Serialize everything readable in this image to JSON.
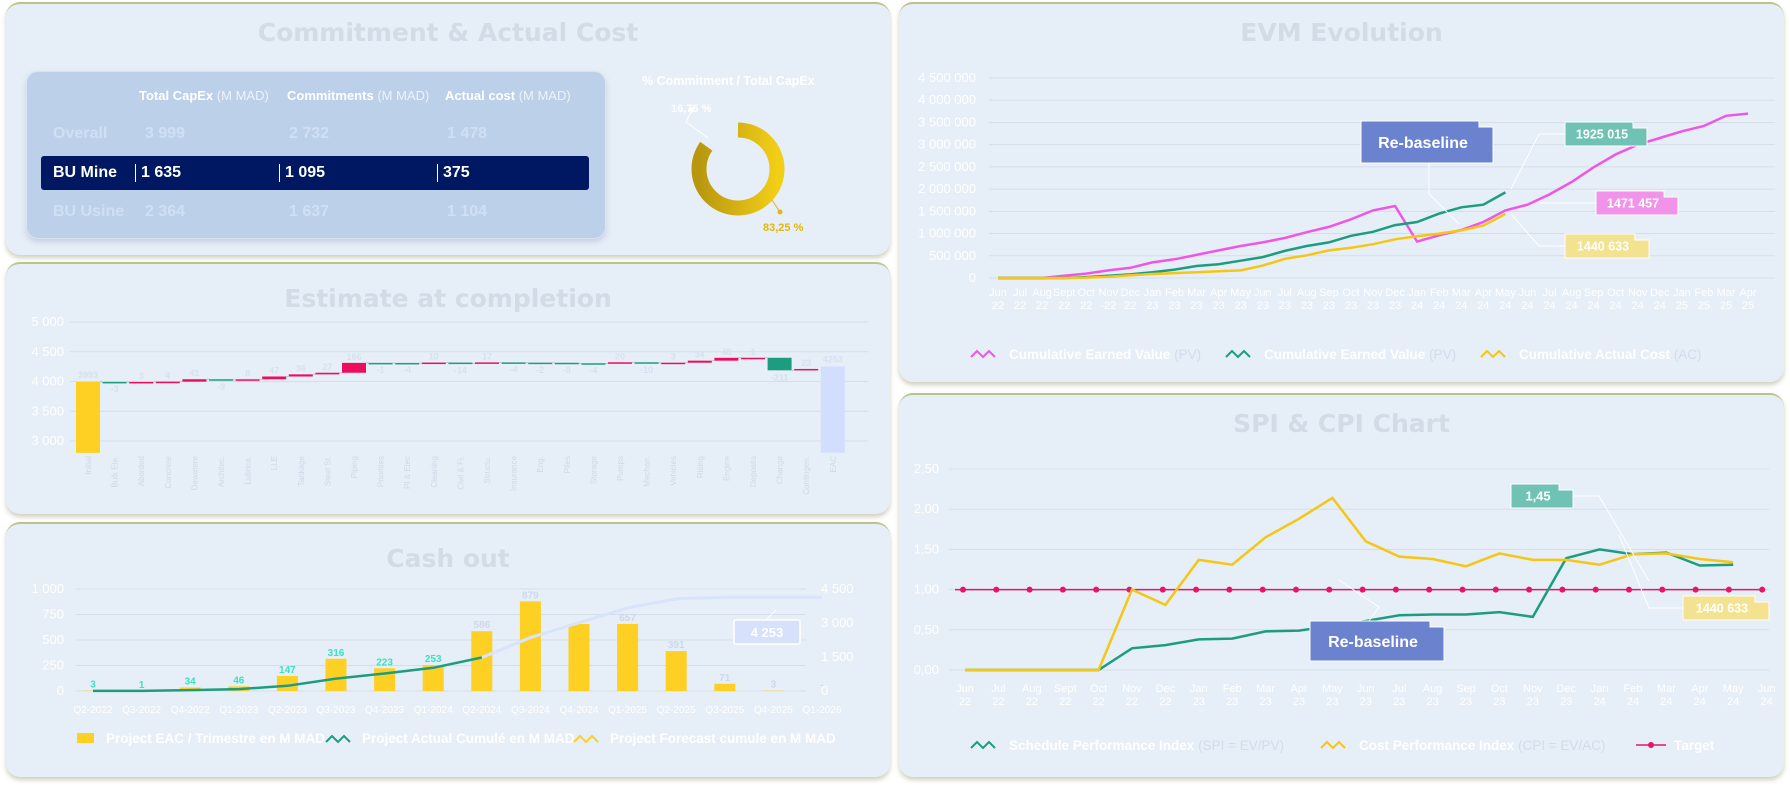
{
  "commitment": {
    "title": "Commitment & Actual Cost",
    "headers": [
      {
        "name": "Total CapEx",
        "unit": "(M MAD)"
      },
      {
        "name": "Commitments",
        "unit": "(M MAD)"
      },
      {
        "name": "Actual cost",
        "unit": "(M MAD)"
      }
    ],
    "rows": [
      {
        "label": "Overall",
        "total": "3 999",
        "commit": "2 732",
        "actual": "1 478"
      },
      {
        "label": "BU Mine",
        "total": "1 635",
        "commit": "1 095",
        "actual": "375"
      },
      {
        "label": "BU Usine",
        "total": "2 364",
        "commit": "1 637",
        "actual": "1 104"
      }
    ],
    "selected_row": 1,
    "donut": {
      "title": "% Commitment / Total CapEx",
      "small_label": "16,75 %",
      "large_label": "83,25 %",
      "small_pct": 16.75,
      "large_pct": 83.25,
      "colors": [
        "#f3ce17",
        "#b8970f"
      ]
    }
  },
  "eac": {
    "title": "Estimate at completion",
    "chart_data": {
      "type": "bar",
      "chart_kind": "waterfall",
      "ylim": [
        2800,
        5000
      ],
      "yticks": [
        "5 000",
        "4 500",
        "4 000",
        "3 500",
        "3 000"
      ],
      "categories": [
        "Initial",
        "Bulk Ele.",
        "Aborded",
        "Concrete",
        "Dewatere",
        "Architec.",
        "Lubrica.",
        "LLE",
        "Tankage",
        "Steel St.",
        "Piping",
        "Priorities",
        "PI & Elec",
        "Cleaning",
        "Civil & Fi.",
        "Structu.",
        "Insurance",
        "Eng.",
        "Piles",
        "Storage",
        "Pumps",
        "Mechan.",
        "Vehicles",
        "Rising",
        "Engine",
        "Deposits",
        "Change",
        "Contingen.",
        "EAC"
      ],
      "values": [
        3993,
        -3,
        3,
        4,
        41,
        -9,
        8,
        47,
        36,
        27,
        166,
        -1,
        -4,
        10,
        -14,
        17,
        -4,
        -2,
        -8,
        -4,
        20,
        -10,
        3,
        34,
        48,
        1,
        -211,
        23,
        4253
      ],
      "labels": [
        "3993",
        "-3",
        "3",
        "4",
        "41",
        "-9",
        "8",
        "47",
        "36",
        "27",
        "166",
        "-1",
        "-4",
        "10",
        "-14",
        "17",
        "-4",
        "-2",
        "-8",
        "-4",
        "20",
        "-10",
        "3",
        "34",
        "48",
        "1",
        "-211",
        "23",
        "4253"
      ],
      "colors": {
        "total": "#fdd023",
        "increase": "#ee0d5c",
        "decrease": "#1d9d80",
        "final": "#d3deff"
      }
    }
  },
  "cashout": {
    "title": "Cash out",
    "chart_data": {
      "type": "bar",
      "categories": [
        "Q2-2022",
        "Q3-2022",
        "Q4-2022",
        "Q1-2023",
        "Q2-2023",
        "Q3-2023",
        "Q4-2023",
        "Q1-2024",
        "Q2-2024",
        "Q3-2024",
        "Q4-2024",
        "Q1-2025",
        "Q2-2025",
        "Q3-2025",
        "Q4-2025",
        "Q1-2026"
      ],
      "left_ylim": [
        0,
        1000
      ],
      "left_yticks": [
        "1 000",
        "750",
        "500",
        "250",
        "0"
      ],
      "right_ylim": [
        0,
        4500
      ],
      "right_yticks": [
        "4 500",
        "3 000",
        "1 500",
        "0"
      ],
      "series": [
        {
          "name": "Project EAC / Trimestre en M MAD",
          "values": [
            3,
            1,
            34,
            46,
            147,
            316,
            223,
            253,
            586,
            879,
            657,
            657,
            391,
            71,
            3,
            0
          ]
        },
        {
          "name": "Project Actual Cumulé en M MAD",
          "values": [
            3,
            4,
            38,
            84,
            231,
            547,
            770,
            1023,
            1478
          ]
        },
        {
          "name": "Project Forecast cumule en M MAD",
          "values": [
            null,
            null,
            null,
            null,
            null,
            null,
            null,
            null,
            1478,
            2357,
            3014,
            3671,
            4062,
            4133,
            4136,
            4136
          ]
        }
      ],
      "bar_labels": [
        "3",
        "1",
        "34",
        "46",
        "147",
        "316",
        "223",
        "253",
        "586",
        "879",
        "",
        "657",
        "391",
        "71",
        "3",
        "-"
      ],
      "callout": "4 253",
      "colors": {
        "bars": "#fdd023",
        "actual": "#1d9d80",
        "forecast": "#d8e3fc"
      }
    }
  },
  "evm": {
    "title": "EVM Evolution",
    "chart_data": {
      "type": "line",
      "ylim": [
        0,
        4500000
      ],
      "yticks": [
        "4 500 000",
        "4 000 000",
        "3 500 000",
        "3 000 000",
        "2 500 000",
        "2 000 000",
        "1 500 000",
        "1 000 000",
        "500 000",
        "0"
      ],
      "x_month": [
        "Jun",
        "Jul",
        "Aug",
        "Sept",
        "Oct",
        "Nov",
        "Dec",
        "Jan",
        "Feb",
        "Mar",
        "Apr",
        "May",
        "Jun",
        "Jul",
        "Aug",
        "Sep",
        "Oct",
        "Nov",
        "Dec",
        "Jan",
        "Feb",
        "Mar",
        "Apr",
        "May",
        "Jun",
        "Jul",
        "Aug",
        "Sep",
        "Oct",
        "Nov",
        "Dec",
        "Jan",
        "Feb",
        "Mar",
        "Apr"
      ],
      "x_year": [
        "22",
        "22",
        "22",
        "22",
        "22",
        "-22",
        "22",
        "23",
        "23",
        "23",
        "23",
        "23",
        "23",
        "23",
        "23",
        "23",
        "23",
        "23",
        "23",
        "24",
        "24",
        "24",
        "24",
        "24",
        "24",
        "24",
        "24",
        "24",
        "24",
        "24",
        "24",
        "25",
        "25",
        "25",
        "25"
      ],
      "series": [
        {
          "name": "Cumulative Earned Value",
          "suffix": "(PV)",
          "color": "#f056e4",
          "values": [
            0,
            0,
            0,
            50000,
            100000,
            170000,
            230000,
            350000,
            420000,
            520000,
            620000,
            720000,
            800000,
            900000,
            1030000,
            1150000,
            1320000,
            1520000,
            1620000,
            820000,
            960000,
            1080000,
            1260000,
            1520000,
            1650000,
            1880000,
            2160000,
            2490000,
            2780000,
            3000000,
            3150000,
            3300000,
            3420000,
            3650000,
            3700000
          ]
        },
        {
          "name": "Cumulative Earned Value",
          "suffix": "(PV)",
          "color": "#1d9d80",
          "values": [
            0,
            0,
            0,
            0,
            20000,
            50000,
            80000,
            130000,
            190000,
            270000,
            310000,
            390000,
            470000,
            610000,
            720000,
            800000,
            950000,
            1040000,
            1190000,
            1260000,
            1450000,
            1590000,
            1650000,
            1925015
          ]
        },
        {
          "name": "Cumulative Actual Cost",
          "suffix": "(AC)",
          "color": "#f6c615",
          "values": [
            0,
            0,
            0,
            0,
            10000,
            30000,
            60000,
            90000,
            110000,
            130000,
            150000,
            170000,
            280000,
            430000,
            510000,
            620000,
            680000,
            760000,
            870000,
            940000,
            1000000,
            1070000,
            1180000,
            1440633
          ]
        }
      ],
      "callouts": [
        {
          "text": "Re-baseline"
        },
        {
          "text": "1925 015"
        },
        {
          "text": "1471 457"
        },
        {
          "text": "1440 633"
        }
      ]
    }
  },
  "spi": {
    "title": "SPI & CPI Chart",
    "chart_data": {
      "type": "line",
      "ylim": [
        0,
        2.5
      ],
      "yticks": [
        "2,50",
        "2,00",
        "1,50",
        "1,00",
        "0,50",
        "0,00"
      ],
      "x_month": [
        "Jun",
        "Jul",
        "Aug",
        "Sept",
        "Oct",
        "Nov",
        "Dec",
        "Jan",
        "Feb",
        "Mar",
        "Apr",
        "May",
        "Jun",
        "Jul",
        "Aug",
        "Sep",
        "Oct",
        "Nov",
        "Dec",
        "Jan",
        "Feb",
        "Mar",
        "Apr",
        "May",
        "Jun"
      ],
      "x_year": [
        "22",
        "22",
        "22",
        "22",
        "22",
        "22",
        "22",
        "23",
        "23",
        "23",
        "23",
        "23",
        "23",
        "23",
        "23",
        "23",
        "23",
        "23",
        "23",
        "24",
        "24",
        "24",
        "24",
        "24",
        "24"
      ],
      "series": [
        {
          "name": "Schedule Performance Index",
          "suffix": "(SPI = EV/PV)",
          "color": "#1d9d80",
          "values": [
            0,
            0,
            0,
            0,
            0,
            0.27,
            0.31,
            0.38,
            0.39,
            0.48,
            0.49,
            0.55,
            0.61,
            0.68,
            0.69,
            0.69,
            0.72,
            0.66,
            1.39,
            1.5,
            1.44,
            1.46,
            1.3,
            1.31
          ]
        },
        {
          "name": "Cost Performance Index",
          "suffix": "(CPI = EV/AC)",
          "color": "#f6c615",
          "values": [
            0,
            0,
            0,
            0,
            0,
            1,
            0.81,
            1.37,
            1.31,
            1.65,
            1.88,
            2.14,
            1.6,
            1.41,
            1.38,
            1.29,
            1.45,
            1.37,
            1.37,
            1.31,
            1.44,
            1.45,
            1.38,
            1.34
          ]
        },
        {
          "name": "Target",
          "suffix": "",
          "color": "#e6156b",
          "values": [
            1,
            1,
            1,
            1,
            1,
            1,
            1,
            1,
            1,
            1,
            1,
            1,
            1,
            1,
            1,
            1,
            1,
            1,
            1,
            1,
            1,
            1,
            1,
            1,
            1,
            1,
            1,
            1,
            1,
            1,
            1,
            1,
            1,
            1,
            1,
            1,
            1,
            1,
            1,
            1,
            1,
            1,
            1,
            1,
            1,
            1,
            1,
            1,
            1,
            1
          ]
        }
      ],
      "callouts": [
        {
          "text": "Re-baseline"
        },
        {
          "text": "1,45"
        },
        {
          "text": "1440 633"
        }
      ]
    }
  }
}
